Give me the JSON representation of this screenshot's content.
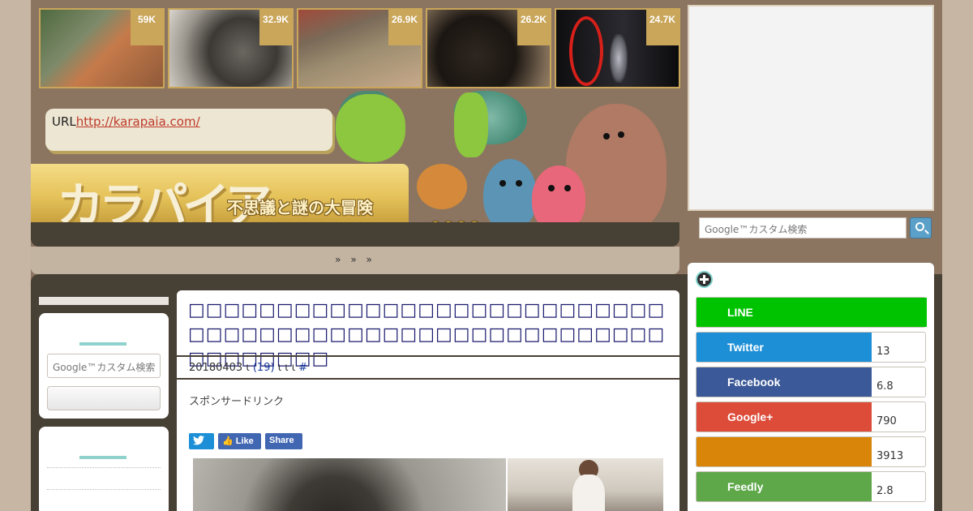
{
  "thumbnails": [
    {
      "count": "59K"
    },
    {
      "count": "32.9K"
    },
    {
      "count": "26.9K"
    },
    {
      "count": "26.2K"
    },
    {
      "count": "24.7K"
    }
  ],
  "header": {
    "url_label": "URL",
    "url_link": "http://karapaia.com/",
    "logo_text": "カラパイア",
    "tagline": "不思議と謎の大冒険"
  },
  "navbar": {
    "breadcrumb": "» » »"
  },
  "search": {
    "placeholder": "Google™カスタム検索"
  },
  "article": {
    "title": "□□□□□□□□□□□□□□□□□□□□□□□□□□□□□□□□□□□□□□□□□□□□□□□□□□□□□□□□□□□□□□",
    "date": "20180403",
    "sep1": "ι",
    "comment_count": "(19)",
    "sep2": "ι ι ι",
    "hash": "#",
    "sponsor": "スポンサードリンク",
    "share": {
      "twitter": "",
      "fb_like": "Like",
      "share": "Share"
    }
  },
  "social": [
    {
      "name": "LINE",
      "count": "",
      "color": "#00c300"
    },
    {
      "name": "Twitter",
      "count": "13",
      "color": "#1d8fd6"
    },
    {
      "name": "Facebook",
      "count": "6.8",
      "color": "#3b5998"
    },
    {
      "name": "Google+",
      "count": "790",
      "color": "#dd4b39"
    },
    {
      "name": "",
      "count": "3913",
      "color": "#d9850a"
    },
    {
      "name": "Feedly",
      "count": "2.8",
      "color": "#5ea84a"
    }
  ]
}
